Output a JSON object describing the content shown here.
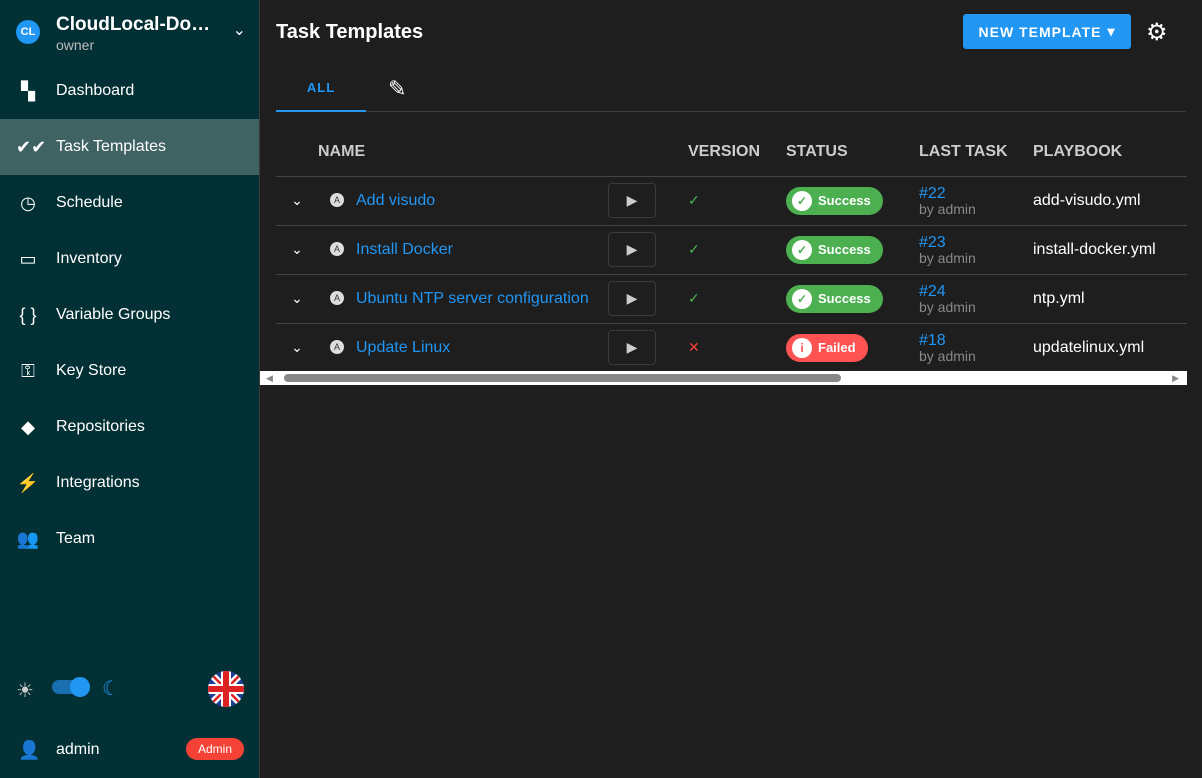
{
  "project": {
    "initials": "CL",
    "name": "CloudLocal-Do…",
    "role": "owner"
  },
  "nav": [
    {
      "label": "Dashboard",
      "icon": "▚",
      "name": "dashboard"
    },
    {
      "label": "Task Templates",
      "icon": "✔✔",
      "name": "task-templates",
      "active": true
    },
    {
      "label": "Schedule",
      "icon": "◷",
      "name": "schedule"
    },
    {
      "label": "Inventory",
      "icon": "▭",
      "name": "inventory"
    },
    {
      "label": "Variable Groups",
      "icon": "{ }",
      "name": "variable-groups"
    },
    {
      "label": "Key Store",
      "icon": "⚿",
      "name": "key-store"
    },
    {
      "label": "Repositories",
      "icon": "◆",
      "name": "repositories"
    },
    {
      "label": "Integrations",
      "icon": "⚡",
      "name": "integrations"
    },
    {
      "label": "Team",
      "icon": "👥",
      "name": "team"
    }
  ],
  "user": {
    "name": "admin",
    "badge": "Admin"
  },
  "header": {
    "title": "Task Templates",
    "new_button": "NEW TEMPLATE"
  },
  "tabs": {
    "all": "ALL"
  },
  "table": {
    "headers": {
      "name": "NAME",
      "version": "VERSION",
      "status": "STATUS",
      "last_task": "LAST TASK",
      "playbook": "PLAYBOOK"
    },
    "rows": [
      {
        "name": "Add visudo",
        "version_ok": true,
        "status": "Success",
        "task": "#22",
        "by": "by admin",
        "playbook": "add-visudo.yml"
      },
      {
        "name": "Install Docker",
        "version_ok": true,
        "status": "Success",
        "task": "#23",
        "by": "by admin",
        "playbook": "install-docker.yml"
      },
      {
        "name": "Ubuntu NTP server configuration",
        "version_ok": true,
        "status": "Success",
        "task": "#24",
        "by": "by admin",
        "playbook": "ntp.yml"
      },
      {
        "name": "Update Linux",
        "version_ok": false,
        "status": "Failed",
        "task": "#18",
        "by": "by admin",
        "playbook": "updatelinux.yml"
      }
    ]
  },
  "colors": {
    "success": "#4caf50",
    "failed": "#ff5252",
    "accent": "#2196f3"
  }
}
